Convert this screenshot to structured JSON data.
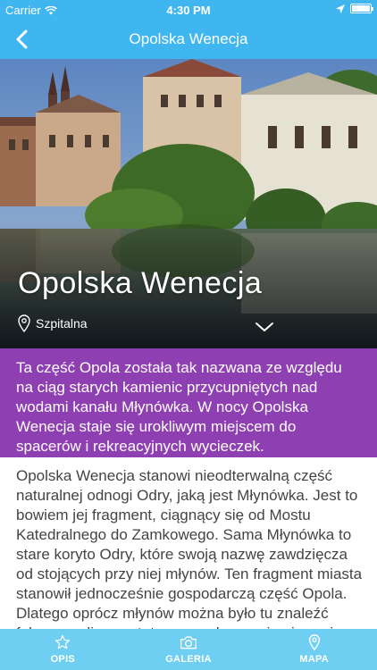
{
  "status": {
    "carrier": "Carrier",
    "time": "4:30 PM"
  },
  "nav": {
    "title": "Opolska Wenecja"
  },
  "hero": {
    "title": "Opolska Wenecja",
    "location": "Szpitalna"
  },
  "intro": {
    "text": "Ta część Opola została tak nazwana ze względu na ciąg starych kamienic przycupniętych nad wodami kanału Młynówka. W nocy Opolska Wenecja staje się urokliwym miejscem do spacerów i rekreacyjnych wycieczek."
  },
  "body": {
    "text": "Opolska Wenecja stanowi nieodterwalną część naturalnej odnogi Odry, jaką jest Młynówka. Jest to bowiem jej fragment, ciągnący się od Mostu Katedralnego do Zamkowego. Sama Młynówka to stare koryto Odry, które swoją nazwę zawdzięcza od stojących przy niej młynów. Ten fragment miasta stanowił jednocześnie gospodarczą część Opola. Dlatego oprócz młynów można było tu znaleźć folusz, czyli warsztat przemysłowy zajmujący się"
  },
  "tabs": [
    {
      "label": "OPIS",
      "icon": "star-icon"
    },
    {
      "label": "GALERIA",
      "icon": "camera-icon"
    },
    {
      "label": "MAPA",
      "icon": "map-pin-icon"
    }
  ],
  "colors": {
    "header": "#3fb6f0",
    "intro_background": "#8e3fb1",
    "tab_bar": "#6ecff2"
  }
}
